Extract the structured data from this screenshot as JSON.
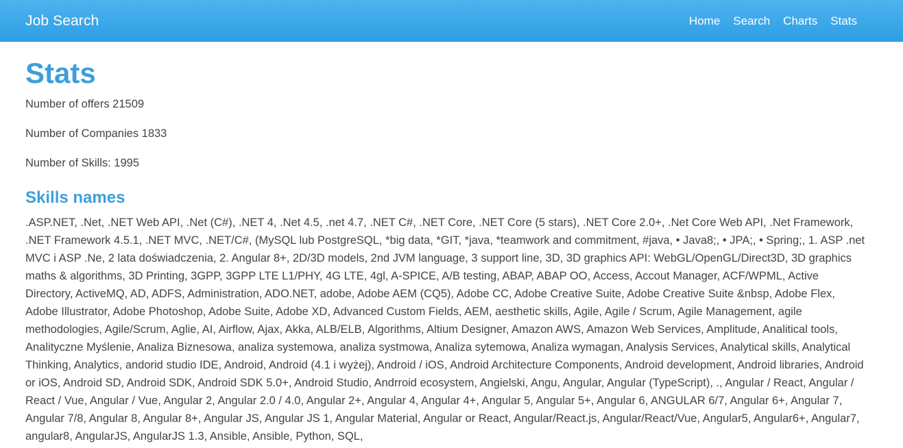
{
  "navbar": {
    "brand": "Job Search",
    "links": [
      "Home",
      "Search",
      "Charts",
      "Stats"
    ]
  },
  "page": {
    "title": "Stats",
    "stats": [
      "Number of offers 21509",
      "Number of Companies 1833",
      "Number of Skills: 1995"
    ],
    "skills_heading": "Skills names",
    "skills_text": ".ASP.NET, .Net, .NET Web API, .Net (C#), .NET 4, .Net 4.5, .net 4.7, .NET C#, .NET Core, .NET Core (5 stars), .NET Core 2.0+, .Net Core Web API, .Net Framework, .NET Framework 4.5.1, .NET MVC, .NET/C#, (MySQL lub PostgreSQL, *big data, *GIT, *java, *teamwork and commitment, #java, • Java8;, • JPA;, • Spring;, 1. ASP .net MVC i ASP .Ne, 2 lata doświadczenia, 2. Angular 8+, 2D/3D models, 2nd JVM language, 3 support line, 3D, 3D graphics API: WebGL/OpenGL/Direct3D, 3D graphics maths & algorithms, 3D Printing, 3GPP, 3GPP LTE L1/PHY, 4G LTE, 4gl, A-SPICE, A/B testing, ABAP, ABAP OO, Access, Accout Manager, ACF/WPML, Active Directory, ActiveMQ, AD, ADFS, Administration, ADO.NET, adobe, Adobe AEM (CQ5), Adobe CC, Adobe Creative Suite, Adobe Creative Suite &nbsp, Adobe Flex, Adobe Illustrator, Adobe Photoshop, Adobe Suite, Adobe XD, Advanced Custom Fields, AEM, aesthetic skills, Agile, Agile / Scrum, Agile Management, agile methodologies, Agile/Scrum, Aglie, AI, Airflow, Ajax, Akka, ALB/ELB, Algorithms, Altium Designer, Amazon AWS, Amazon Web Services, Amplitude, Analitical tools, Analityczne Myślenie, Analiza Biznesowa, analiza systemowa, analiza systmowa, Analiza sytemowa, Analiza wymagan, Analysis Services, Analytical skills, Analytical Thinking, Analytics, andorid studio IDE, Android, Android (4.1 i wyżej), Android / iOS, Android Architecture Components, Android development, Android libraries, Android or iOS, Android SD, Android SDK, Android SDK 5.0+, Android Studio, Andrroid ecosystem, Angielski, Angu, Angular, Angular (TypeScript), ., Angular / React, Angular / React / Vue, Angular / Vue, Angular 2, Angular 2.0 / 4.0, Angular 2+, Angular 4, Angular 4+, Angular 5, Angular 5+, Angular 6, ANGULAR 6/7, Angular 6+, Angular 7, Angular 7/8, Angular 8, Angular 8+, Angular JS, Angular JS 1, Angular Material, Angular or React, Angular/React.js, Angular/React/Vue, Angular5, Angular6+, Angular7, angular8, AngularJS, AngularJS 1.3, Ansible, Ansible, Python, SQL,"
  }
}
